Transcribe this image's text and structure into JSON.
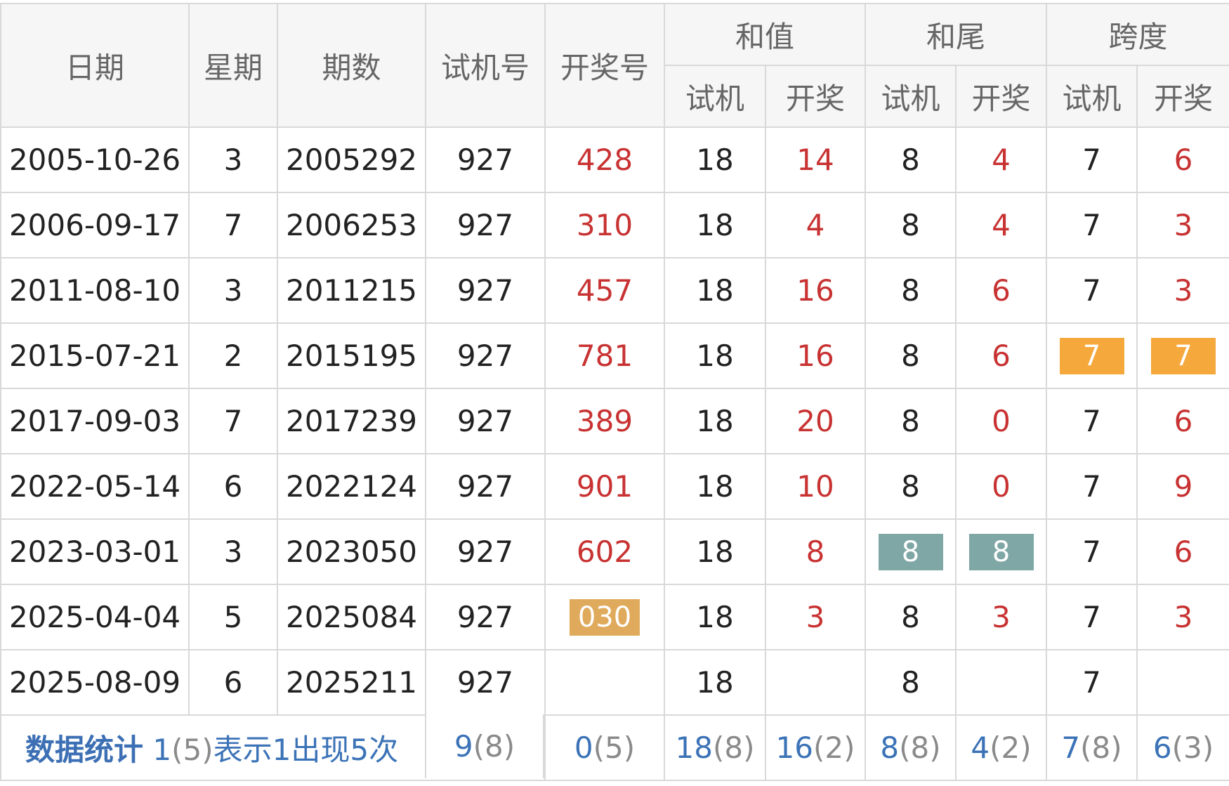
{
  "header": {
    "date": "日期",
    "weekday": "星期",
    "issue": "期数",
    "trial_number": "试机号",
    "draw_number": "开奖号",
    "sum": "和值",
    "sum_tail": "和尾",
    "span": "跨度",
    "sub_trial": "试机",
    "sub_draw": "开奖"
  },
  "rows": [
    {
      "date": "2005-10-26",
      "weekday": "3",
      "issue": "2005292",
      "trial": "927",
      "draw": "428",
      "sum_trial": "18",
      "sum_draw": "14",
      "tail_trial": "8",
      "tail_draw": "4",
      "span_trial": "7",
      "span_draw": "6"
    },
    {
      "date": "2006-09-17",
      "weekday": "7",
      "issue": "2006253",
      "trial": "927",
      "draw": "310",
      "sum_trial": "18",
      "sum_draw": "4",
      "tail_trial": "8",
      "tail_draw": "4",
      "span_trial": "7",
      "span_draw": "3"
    },
    {
      "date": "2011-08-10",
      "weekday": "3",
      "issue": "2011215",
      "trial": "927",
      "draw": "457",
      "sum_trial": "18",
      "sum_draw": "16",
      "tail_trial": "8",
      "tail_draw": "6",
      "span_trial": "7",
      "span_draw": "3"
    },
    {
      "date": "2015-07-21",
      "weekday": "2",
      "issue": "2015195",
      "trial": "927",
      "draw": "781",
      "sum_trial": "18",
      "sum_draw": "16",
      "tail_trial": "8",
      "tail_draw": "6",
      "span_trial": "7",
      "span_draw": "7"
    },
    {
      "date": "2017-09-03",
      "weekday": "7",
      "issue": "2017239",
      "trial": "927",
      "draw": "389",
      "sum_trial": "18",
      "sum_draw": "20",
      "tail_trial": "8",
      "tail_draw": "0",
      "span_trial": "7",
      "span_draw": "6"
    },
    {
      "date": "2022-05-14",
      "weekday": "6",
      "issue": "2022124",
      "trial": "927",
      "draw": "901",
      "sum_trial": "18",
      "sum_draw": "10",
      "tail_trial": "8",
      "tail_draw": "0",
      "span_trial": "7",
      "span_draw": "9"
    },
    {
      "date": "2023-03-01",
      "weekday": "3",
      "issue": "2023050",
      "trial": "927",
      "draw": "602",
      "sum_trial": "18",
      "sum_draw": "8",
      "tail_trial": "8",
      "tail_draw": "8",
      "span_trial": "7",
      "span_draw": "6"
    },
    {
      "date": "2025-04-04",
      "weekday": "5",
      "issue": "2025084",
      "trial": "927",
      "draw": "030",
      "sum_trial": "18",
      "sum_draw": "3",
      "tail_trial": "8",
      "tail_draw": "3",
      "span_trial": "7",
      "span_draw": "3"
    },
    {
      "date": "2025-08-09",
      "weekday": "6",
      "issue": "2025211",
      "trial": "927",
      "draw": "",
      "sum_trial": "18",
      "sum_draw": "",
      "tail_trial": "8",
      "tail_draw": "",
      "span_trial": "7",
      "span_draw": ""
    }
  ],
  "highlights": {
    "span_match_color": "#f5a83c",
    "tail_match_color": "#7fa7a6",
    "draw_highlight_color": "#e0aa5c",
    "red_text_color": "#c83232",
    "stats_blue": "#3c73b7"
  },
  "stats": {
    "title": "数据统计",
    "legend": {
      "num": "1",
      "count": "(5)",
      "text1": "表示",
      "num2": "1",
      "text2": "出现",
      "num3": "5",
      "text3": "次"
    },
    "trial": {
      "num": "9",
      "count": "(8)"
    },
    "draw": {
      "num": "0",
      "count": "(5)"
    },
    "sum_trial": {
      "num": "18",
      "count": "(8)"
    },
    "sum_draw": {
      "num": "16",
      "count": "(2)"
    },
    "tail_trial": {
      "num": "8",
      "count": "(8)"
    },
    "tail_draw": {
      "num": "4",
      "count": "(2)"
    },
    "span_trial": {
      "num": "7",
      "count": "(8)"
    },
    "span_draw": {
      "num": "6",
      "count": "(3)"
    }
  }
}
